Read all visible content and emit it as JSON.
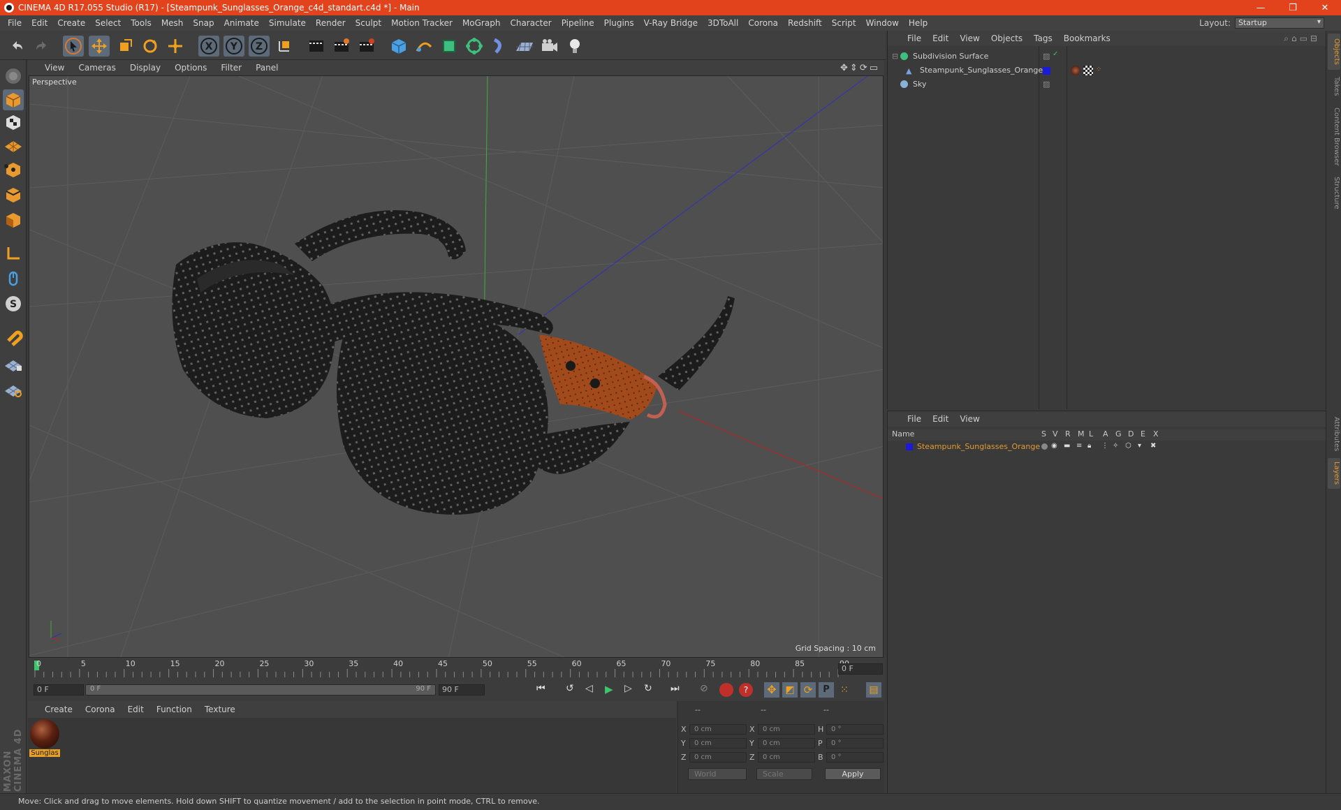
{
  "window": {
    "title": "CINEMA 4D R17.055 Studio (R17) - [Steampunk_Sunglasses_Orange_c4d_standart.c4d *] - Main",
    "controls": [
      "—",
      "❐",
      "✕"
    ]
  },
  "menubar": {
    "items": [
      "File",
      "Edit",
      "Create",
      "Select",
      "Tools",
      "Mesh",
      "Snap",
      "Animate",
      "Simulate",
      "Render",
      "Sculpt",
      "Motion Tracker",
      "MoGraph",
      "Character",
      "Pipeline",
      "Plugins",
      "V-Ray Bridge",
      "3DToAll",
      "Corona",
      "Redshift",
      "Script",
      "Window",
      "Help"
    ],
    "layout_label": "Layout:",
    "layout_value": "Startup"
  },
  "viewport": {
    "menu": [
      "View",
      "Cameras",
      "Display",
      "Options",
      "Filter",
      "Panel"
    ],
    "label": "Perspective",
    "grid_spacing": "Grid Spacing : 10 cm"
  },
  "timeline": {
    "ticks": [
      "0",
      "5",
      "10",
      "15",
      "20",
      "25",
      "30",
      "35",
      "40",
      "45",
      "50",
      "55",
      "60",
      "65",
      "70",
      "75",
      "80",
      "85",
      "90"
    ],
    "current_frame": "0 F",
    "start_field": "0 F",
    "range_start": "0 F",
    "range_end": "90 F",
    "end_field": "90 F"
  },
  "material_panel": {
    "menu": [
      "Create",
      "Corona",
      "Edit",
      "Function",
      "Texture"
    ],
    "materials": [
      {
        "name": "Sunglas"
      }
    ]
  },
  "coordinates": {
    "header": [
      "--",
      "--",
      "--"
    ],
    "rows": [
      {
        "a": "X",
        "av": "0 cm",
        "b": "X",
        "bv": "0 cm",
        "c": "H",
        "cv": "0 °"
      },
      {
        "a": "Y",
        "av": "0 cm",
        "b": "Y",
        "bv": "0 cm",
        "c": "P",
        "cv": "0 °"
      },
      {
        "a": "Z",
        "av": "0 cm",
        "b": "Z",
        "bv": "0 cm",
        "c": "B",
        "cv": "0 °"
      }
    ],
    "world": "World",
    "scale": "Scale",
    "apply": "Apply"
  },
  "object_manager": {
    "menu": [
      "File",
      "Edit",
      "View",
      "Objects",
      "Tags",
      "Bookmarks"
    ],
    "objects": [
      {
        "name": "Subdivision Surface"
      },
      {
        "name": "Steampunk_Sunglasses_Orange"
      },
      {
        "name": "Sky"
      }
    ]
  },
  "layer_manager": {
    "menu": [
      "File",
      "Edit",
      "View"
    ],
    "columns": [
      "Name",
      "S",
      "V",
      "R",
      "M",
      "L",
      "A",
      "G",
      "D",
      "E",
      "X"
    ],
    "layers": [
      {
        "name": "Steampunk_Sunglasses_Orange",
        "color": "#1a1ad8"
      }
    ]
  },
  "right_tabs": [
    "Objects",
    "Takes",
    "Content Browser",
    "Structure",
    "Attributes",
    "Layers"
  ],
  "status": "Move: Click and drag to move elements. Hold down SHIFT to quantize movement / add to the selection in point mode, CTRL to remove.",
  "brand": "MAXON CINEMA 4D",
  "colors": {
    "accent": "#e2431c",
    "highlight": "#e39a2e",
    "selected_blue": "#5c6a7a"
  }
}
